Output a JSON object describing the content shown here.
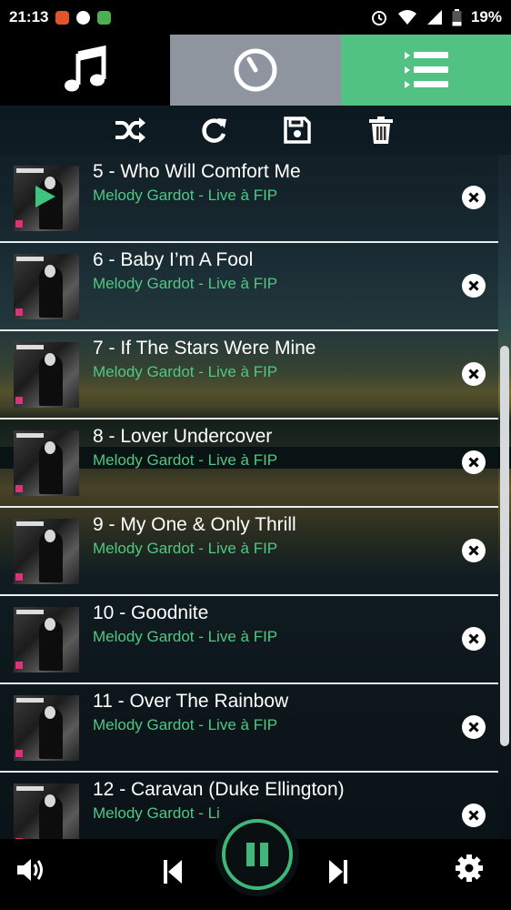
{
  "status_bar": {
    "time": "21:13",
    "battery": "19%"
  },
  "tabs": [
    {
      "icon": "music-note-icon"
    },
    {
      "icon": "timer-icon"
    },
    {
      "icon": "queue-list-icon"
    }
  ],
  "toolbar": {
    "icons": [
      "shuffle-icon",
      "repeat-icon",
      "save-icon",
      "trash-icon"
    ]
  },
  "queue": [
    {
      "title": "5 - Who Will Comfort Me",
      "subtitle": "Melody Gardot - Live à FIP",
      "playing": true
    },
    {
      "title": "6 - Baby I’m A Fool",
      "subtitle": "Melody Gardot - Live à FIP"
    },
    {
      "title": "7 - If The Stars Were Mine",
      "subtitle": "Melody Gardot - Live à FIP"
    },
    {
      "title": "8 - Lover Undercover",
      "subtitle": "Melody Gardot - Live à FIP"
    },
    {
      "title": "9 - My One & Only Thrill",
      "subtitle": "Melody Gardot - Live à FIP"
    },
    {
      "title": "10 - Goodnite",
      "subtitle": "Melody Gardot - Live à FIP"
    },
    {
      "title": "11 - Over The Rainbow",
      "subtitle": "Melody Gardot - Live à FIP"
    },
    {
      "title": "12 - Caravan (Duke Ellington)",
      "subtitle": "Melody Gardot - Li"
    }
  ],
  "player": {
    "state": "playing",
    "icons": [
      "volume-icon",
      "previous-icon",
      "pause-icon",
      "next-icon",
      "settings-icon"
    ]
  },
  "colors": {
    "accent": "#52c282",
    "subtitle": "#4fc883",
    "timer_tab": "#8f959e"
  }
}
